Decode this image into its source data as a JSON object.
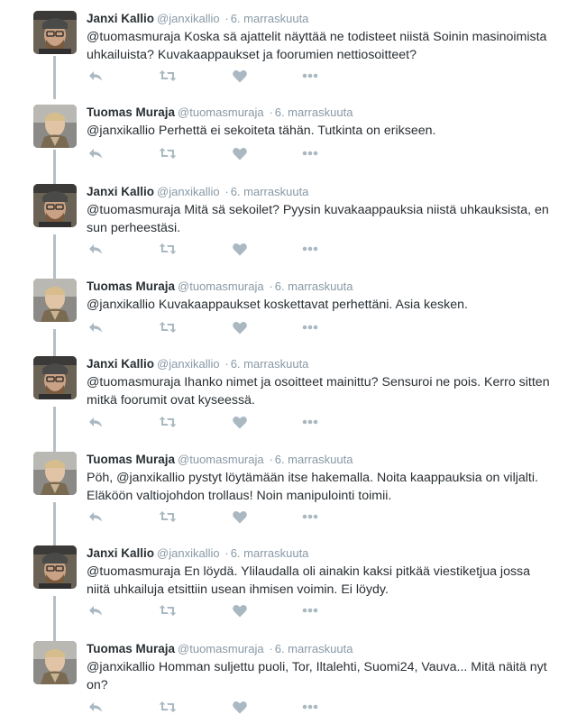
{
  "colors": {
    "name": "#292f33",
    "meta": "#8899a6",
    "icon": "#aab8c2",
    "thread_line": "#b5bfc6"
  },
  "icons": {
    "reply": "reply-icon",
    "retweet": "retweet-icon",
    "like": "heart-icon",
    "more": "more-icon"
  },
  "tweets": [
    {
      "name": "Janxi Kallio",
      "handle": "@janxikallio",
      "dot": "·",
      "time": "6. marraskuuta",
      "text": "@tuomasmuraja Koska sä ajattelit näyttää ne todisteet niistä Soinin masinoimista uhkailuista? Kuvakaappaukset ja foorumien nettiosoitteet?"
    },
    {
      "name": "Tuomas Muraja",
      "handle": "@tuomasmuraja",
      "dot": "·",
      "time": "6. marraskuuta",
      "text": "@janxikallio Perhettä ei sekoiteta tähän. Tutkinta on erikseen."
    },
    {
      "name": "Janxi Kallio",
      "handle": "@janxikallio",
      "dot": "·",
      "time": "6. marraskuuta",
      "text": "@tuomasmuraja Mitä sä sekoilet? Pyysin kuvakaappauksia niistä uhkauksista, en sun perheestäsi."
    },
    {
      "name": "Tuomas Muraja",
      "handle": "@tuomasmuraja",
      "dot": "·",
      "time": "6. marraskuuta",
      "text": "@janxikallio Kuvakaappaukset koskettavat perhettäni. Asia kesken."
    },
    {
      "name": "Janxi Kallio",
      "handle": "@janxikallio",
      "dot": "·",
      "time": "6. marraskuuta",
      "text": "@tuomasmuraja Ihanko nimet ja osoitteet mainittu? Sensuroi ne pois. Kerro sitten mitkä foorumit ovat kyseessä."
    },
    {
      "name": "Tuomas Muraja",
      "handle": "@tuomasmuraja",
      "dot": "·",
      "time": "6. marraskuuta",
      "text": "Pöh, @janxikallio pystyt löytämään itse hakemalla. Noita kaappauksia on viljalti. Eläköön valtiojohdon trollaus! Noin manipulointi toimii."
    },
    {
      "name": "Janxi Kallio",
      "handle": "@janxikallio",
      "dot": "·",
      "time": "6. marraskuuta",
      "text": "@tuomasmuraja En löydä. Ylilaudalla oli ainakin kaksi pitkää viestiketjua jossa niitä uhkailuja etsittiin usean ihmisen voimin. Ei löydy."
    },
    {
      "name": "Tuomas Muraja",
      "handle": "@tuomasmuraja",
      "dot": "·",
      "time": "6. marraskuuta",
      "text": "@janxikallio Homman suljettu puoli, Tor, Iltalehti, Suomi24, Vauva... Mitä näitä nyt on?"
    }
  ]
}
